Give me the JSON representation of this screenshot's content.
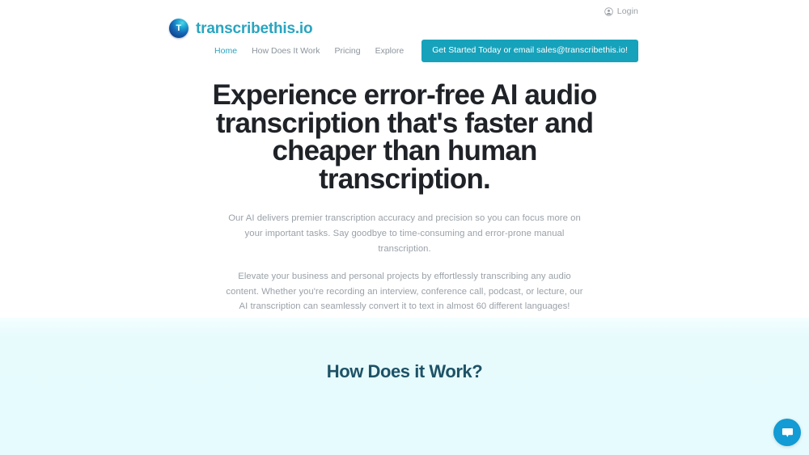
{
  "site": {
    "brand_letter": "T",
    "brand_name": "transcribethis.io",
    "accent_color": "#2aa5c0",
    "cta_color": "#17a2bb",
    "chat_color": "#129bd4",
    "section_bg_color": "#e6fbfd",
    "heading_color": "#1e5266"
  },
  "utility": {
    "login_label": "Login",
    "login_icon": "user-circle-icon"
  },
  "nav": {
    "links": [
      {
        "label": "Home",
        "active": true
      },
      {
        "label": "How Does It Work",
        "active": false
      },
      {
        "label": "Pricing",
        "active": false
      },
      {
        "label": "Explore",
        "active": false
      }
    ],
    "cta_label": "Get Started Today or email sales@transcribethis.io!"
  },
  "hero": {
    "title": "Experience error-free AI audio transcription that's faster and cheaper than human transcription.",
    "paragraphs": [
      "Our AI delivers premier transcription accuracy and precision so you can focus more on your important tasks. Say goodbye to time-consuming and error-prone manual transcription.",
      "Elevate your business and personal projects by effortlessly transcribing any audio content. Whether you're recording an interview, conference call, podcast, or lecture, our AI transcription can seamlessly convert it to text in almost 60 different languages!"
    ]
  },
  "howitworks": {
    "title": "How Does it Work?"
  },
  "chat": {
    "icon": "chat-bubble-icon",
    "label": "Open chat"
  }
}
